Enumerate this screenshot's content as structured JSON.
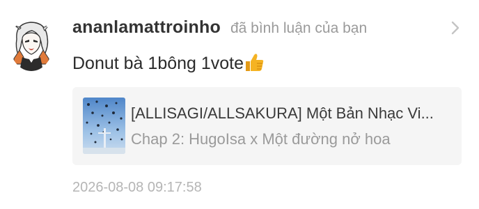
{
  "notification": {
    "username": "ananlamattroinho",
    "action": "đã bình luận của bạn",
    "comment": {
      "text": "Donut bà 1bông 1vote",
      "emoji": "thumbs-up"
    },
    "story": {
      "title": "[ALLISAGI/ALLSAKURA] Một Bản Nhạc Vi...",
      "chapter": "Chap 2: HugoIsa x Một đường nở hoa"
    },
    "timestamp": "2026-08-08 09:17:58"
  },
  "colors": {
    "username": "#333333",
    "secondary_text": "#9a9a9a",
    "timestamp": "#b5b5b5",
    "card_background": "#f5f5f5",
    "emoji": "#f5b323"
  }
}
